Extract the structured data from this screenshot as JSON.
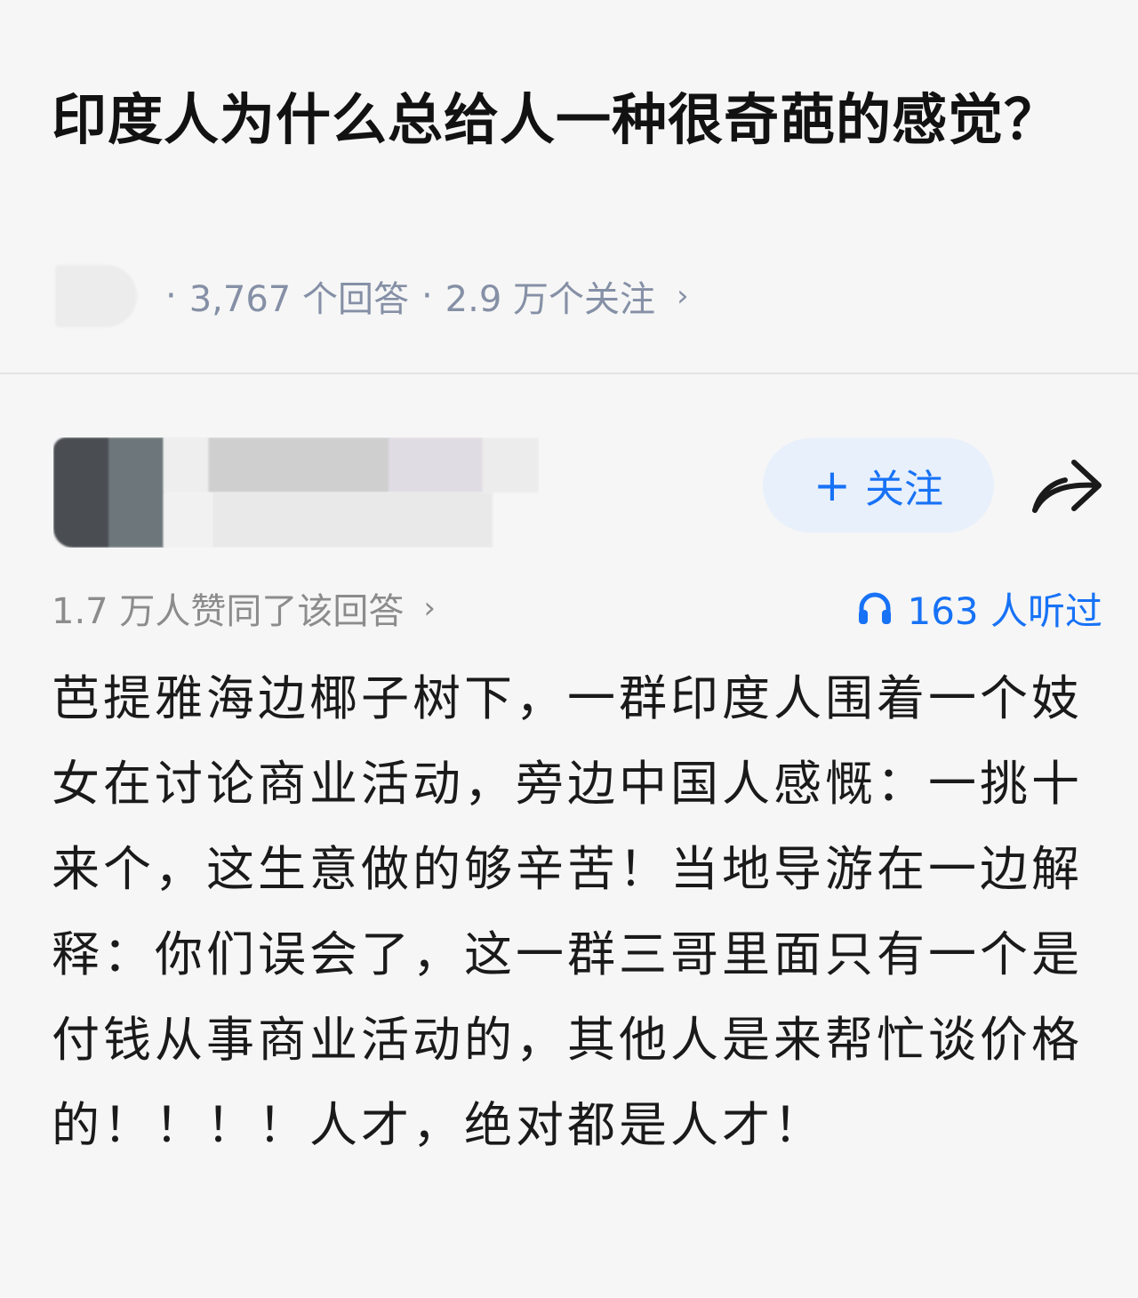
{
  "question": {
    "title": "印度人为什么总给人一种很奇葩的感觉？",
    "answer_count": "3,767 个回答",
    "follower_count": "2.9 万个关注",
    "separator": "·",
    "chevron": "›"
  },
  "author": {
    "follow_plus": "+",
    "follow_label": "关注"
  },
  "stats": {
    "upvotes": "1.7 万人赞同了该回答",
    "upvotes_chevron": "›",
    "listeners": "163 人听过"
  },
  "answer": {
    "text": "芭提雅海边椰子树下，一群印度人围着一个妓女在讨论商业活动，旁边中国人感慨：一挑十来个，这生意做的够辛苦！当地导游在一边解释：你们误会了，这一群三哥里面只有一个是付钱从事商业活动的，其他人是来帮忙谈价格的！！！！人才，绝对都是人才！"
  },
  "colors": {
    "accent": "#1772f6",
    "meta_gray": "#8590a6",
    "follow_bg": "#e8f0fb"
  },
  "icons": {
    "share": "share-arrow-icon",
    "listen": "headphones-icon"
  }
}
